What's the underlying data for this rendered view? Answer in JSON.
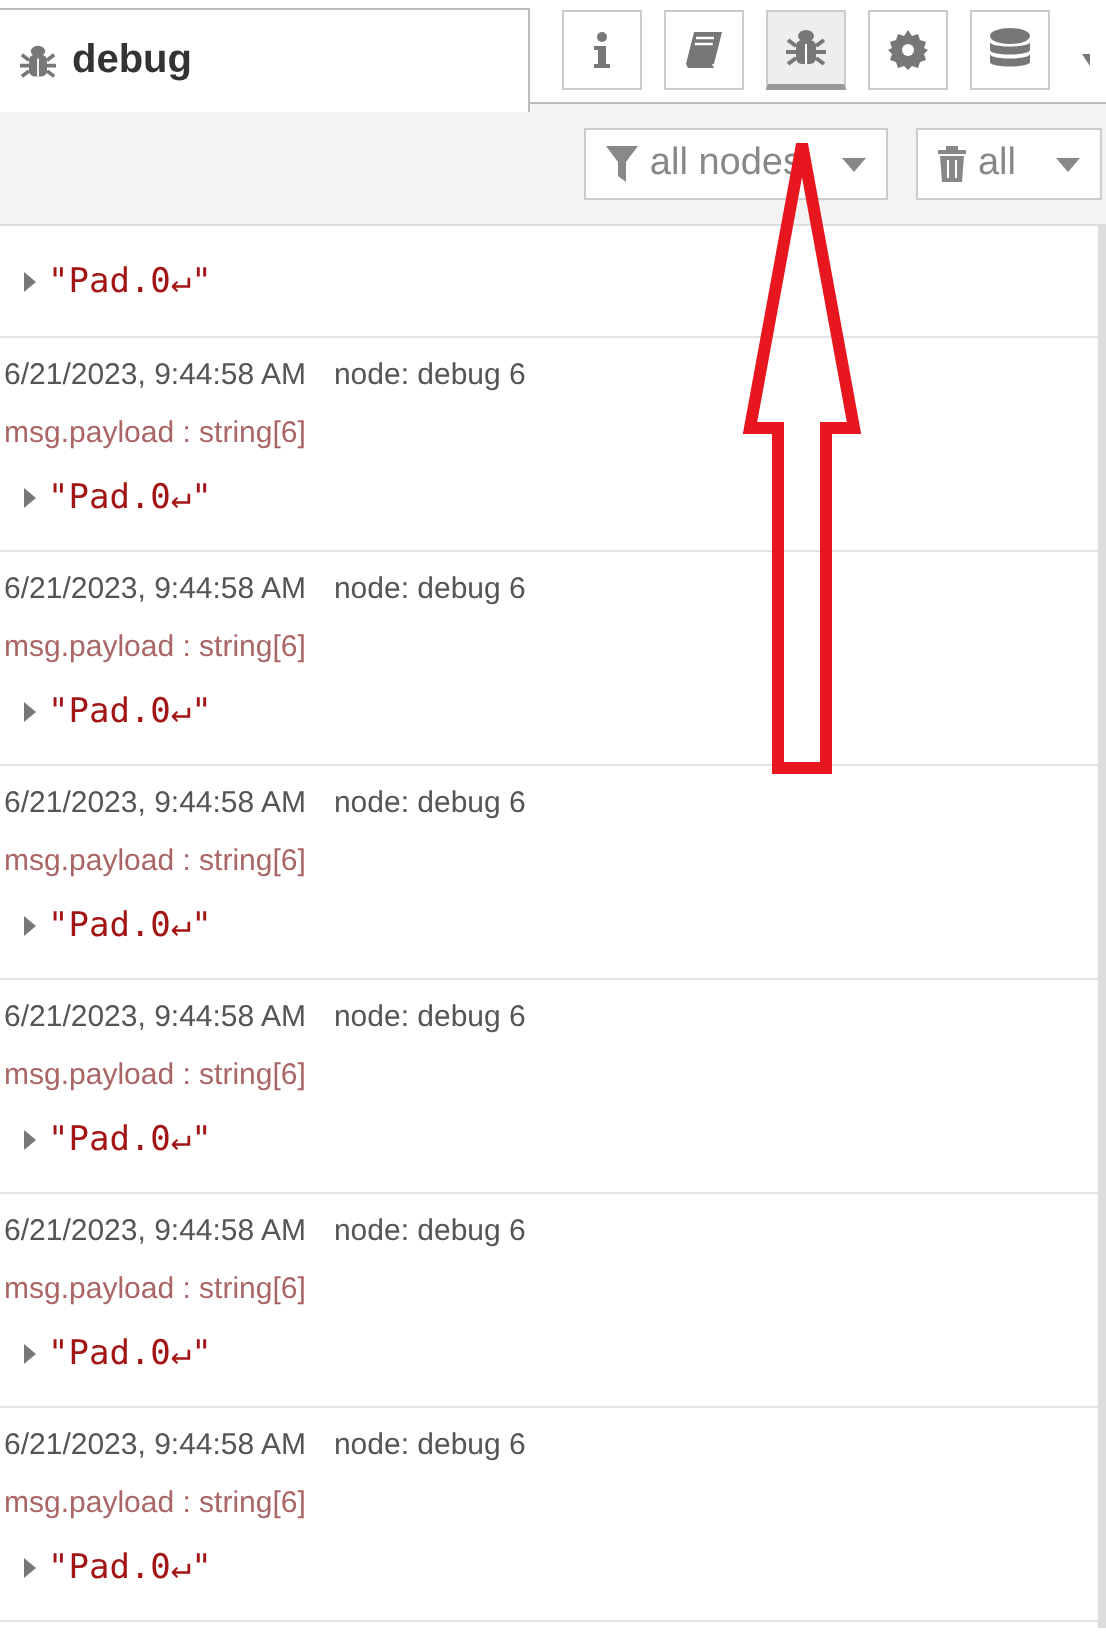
{
  "tab": {
    "title": "debug"
  },
  "sidebar_buttons": [
    {
      "kind": "info",
      "selected": false
    },
    {
      "kind": "book",
      "selected": false
    },
    {
      "kind": "bug",
      "selected": true
    },
    {
      "kind": "gear",
      "selected": false
    },
    {
      "kind": "database",
      "selected": false
    }
  ],
  "toolbar": {
    "filter": "all nodes",
    "clear": "all"
  },
  "messages": [
    {
      "value": "\"Pad.0↵\""
    },
    {
      "time": "6/21/2023, 9:44:58 AM",
      "node": "node: debug 6",
      "topic": "msg.payload : string[6]",
      "value": "\"Pad.0↵\""
    },
    {
      "time": "6/21/2023, 9:44:58 AM",
      "node": "node: debug 6",
      "topic": "msg.payload : string[6]",
      "value": "\"Pad.0↵\""
    },
    {
      "time": "6/21/2023, 9:44:58 AM",
      "node": "node: debug 6",
      "topic": "msg.payload : string[6]",
      "value": "\"Pad.0↵\""
    },
    {
      "time": "6/21/2023, 9:44:58 AM",
      "node": "node: debug 6",
      "topic": "msg.payload : string[6]",
      "value": "\"Pad.0↵\""
    },
    {
      "time": "6/21/2023, 9:44:58 AM",
      "node": "node: debug 6",
      "topic": "msg.payload : string[6]",
      "value": "\"Pad.0↵\""
    },
    {
      "time": "6/21/2023, 9:44:58 AM",
      "node": "node: debug 6",
      "topic": "msg.payload : string[6]",
      "value": "\"Pad.0↵\""
    }
  ],
  "annotation": {
    "kind": "arrow"
  }
}
